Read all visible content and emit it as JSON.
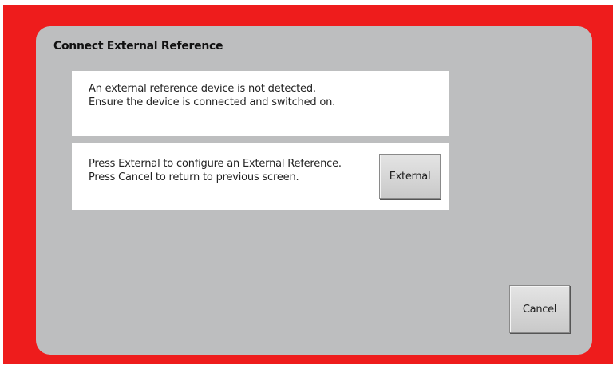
{
  "dialog": {
    "title": "Connect External Reference",
    "message": {
      "line1": "An external reference device is not detected.",
      "line2": "Ensure the device is connected and switched on."
    },
    "instructions": {
      "line1": "Press External to configure an External Reference.",
      "line2": "Press Cancel to return to previous screen."
    },
    "buttons": {
      "external": "External",
      "cancel": "Cancel"
    }
  },
  "colors": {
    "frame": "#ee1c1c",
    "dialog_background": "#bdbebf",
    "panel_background": "#ffffff"
  }
}
